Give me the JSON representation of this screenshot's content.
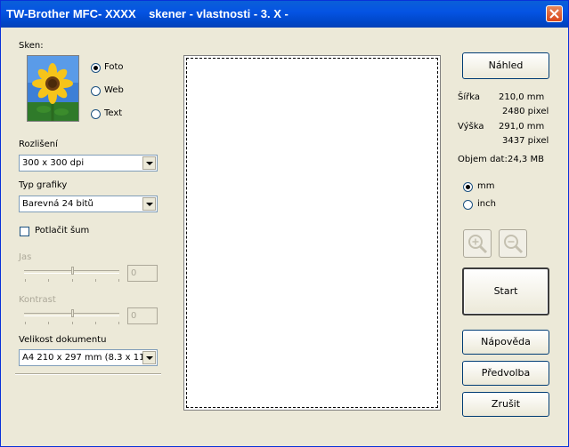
{
  "window": {
    "title": "TW-Brother MFC- XXXX    skener - vlastnosti - 3. X -"
  },
  "scan": {
    "label": "Sken:",
    "options": [
      {
        "label": "Foto",
        "selected": true
      },
      {
        "label": "Web",
        "selected": false
      },
      {
        "label": "Text",
        "selected": false
      }
    ]
  },
  "resolution": {
    "label": "Rozlišení",
    "value": "300 x 300 dpi"
  },
  "graphics_type": {
    "label": "Typ grafiky",
    "value": "Barevná 24 bitů"
  },
  "noise": {
    "label": "Potlačit šum",
    "checked": false
  },
  "brightness": {
    "label": "Jas",
    "value": "0",
    "level": 0.5
  },
  "contrast": {
    "label": "Kontrast",
    "value": "0",
    "level": 0.5
  },
  "doc_size": {
    "label": "Velikost dokumentu",
    "value": "A4 210 x 297 mm (8.3 x 11."
  },
  "buttons": {
    "preview": "Náhled",
    "start": "Start",
    "help": "Nápověda",
    "defaults": "Předvolba",
    "cancel": "Zrušit"
  },
  "info": {
    "width_label": "Šířka",
    "width_mm": "210,0 mm",
    "width_px": "2480 pixel",
    "height_label": "Výška",
    "height_mm": "291,0 mm",
    "height_px": "3437 pixel",
    "size_label": "Objem dat:",
    "size_value": "24,3 MB"
  },
  "units": [
    {
      "label": "mm",
      "selected": true
    },
    {
      "label": "inch",
      "selected": false
    }
  ],
  "icons": {
    "close": "close-icon",
    "zoom_in": "zoom-in-icon",
    "zoom_out": "zoom-out-icon",
    "thumbnail": "sunflower-photo"
  }
}
